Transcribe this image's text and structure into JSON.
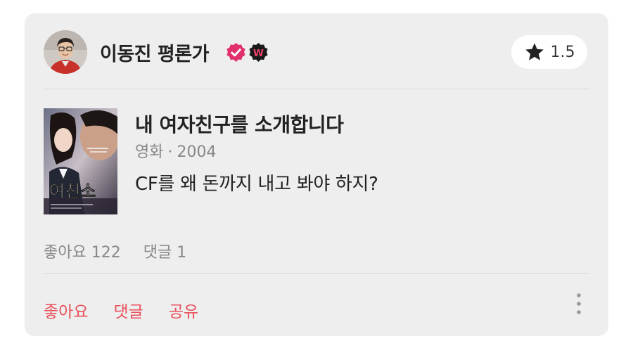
{
  "author": {
    "name": "이동진 평론가",
    "badges": [
      "verified-badge-icon",
      "watcha-w-badge-icon"
    ],
    "badge_text": "W"
  },
  "rating": {
    "icon": "star-icon",
    "value": "1.5"
  },
  "movie": {
    "title": "내 여자친구를 소개합니다",
    "category": "영화",
    "separator": "·",
    "year": "2004",
    "poster_text": "여친소"
  },
  "review": {
    "text": "CF를 왜 돈까지 내고 봐야 하지?"
  },
  "stats": {
    "likes": "좋아요 122",
    "comments": "댓글 1"
  },
  "actions": {
    "like": "좋아요",
    "comment": "댓글",
    "share": "공유",
    "more_icon": "more-vertical-icon"
  },
  "colors": {
    "card_bg": "#eeeeee",
    "accent": "#e8505b",
    "badge_pink": "#e1306c"
  }
}
